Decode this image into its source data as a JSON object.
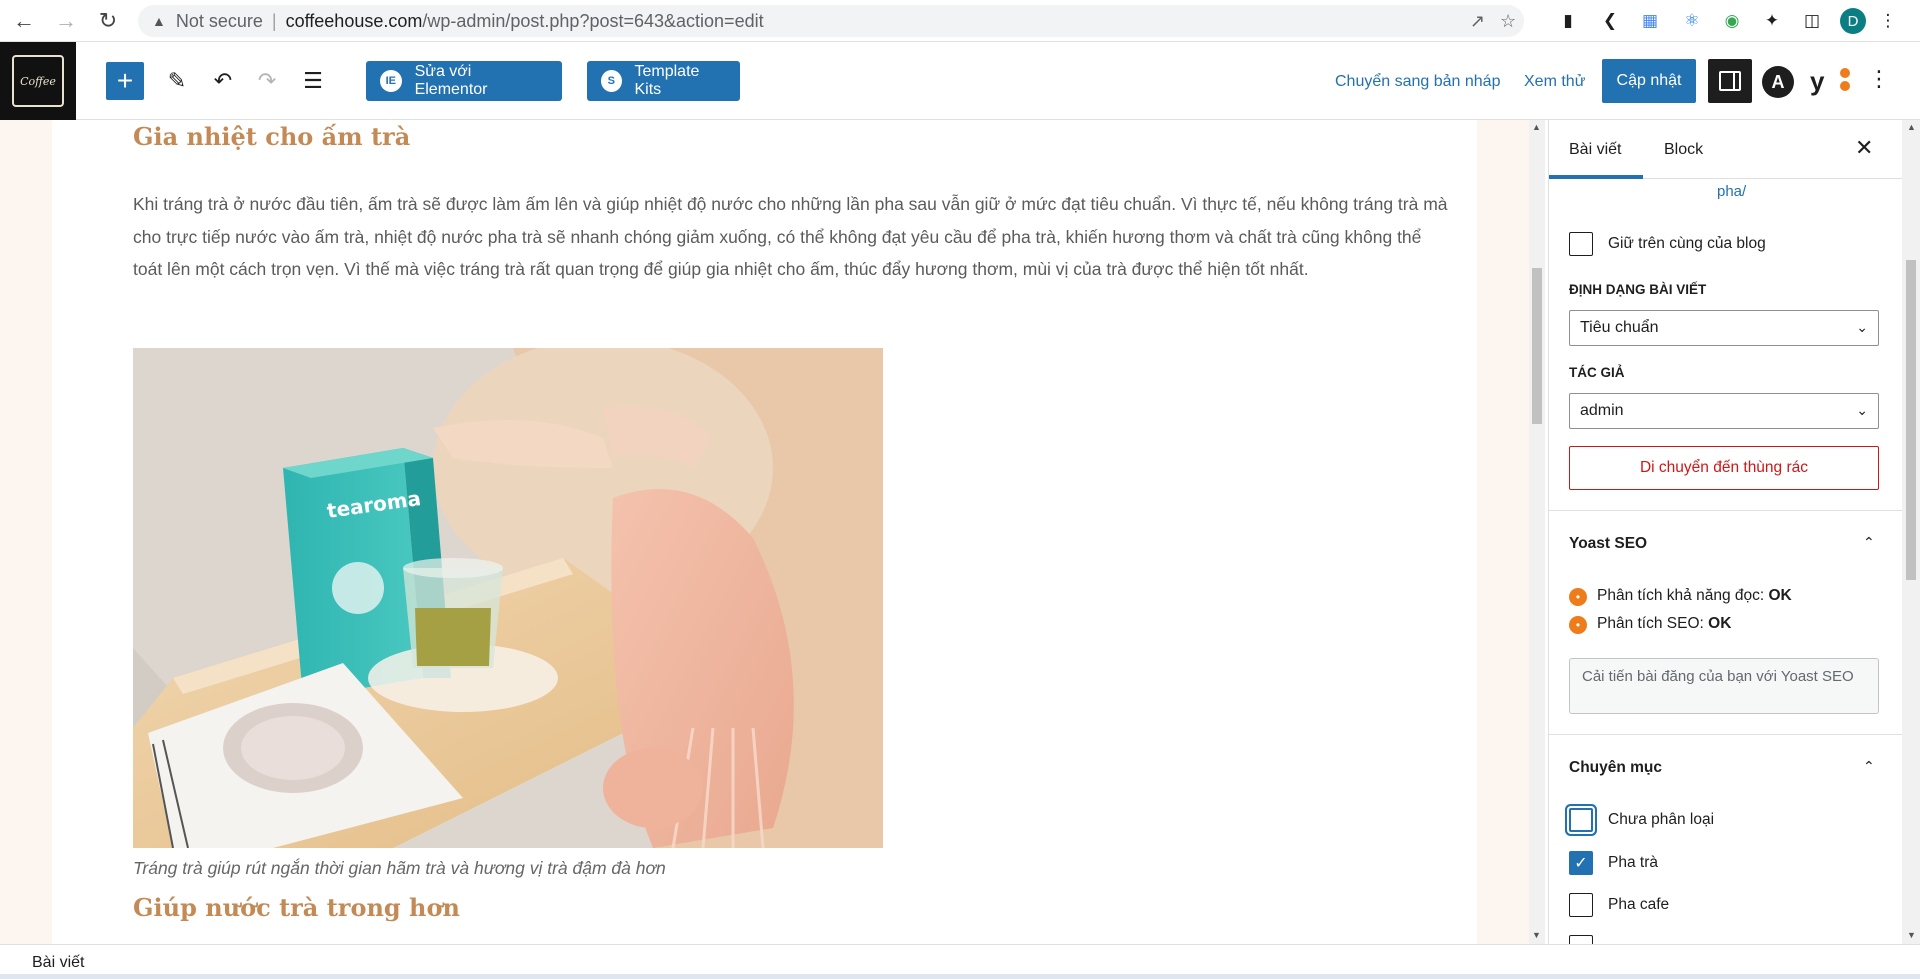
{
  "browser": {
    "not_secure": "Not secure",
    "separator": "|",
    "url_host": "coffeehouse.com",
    "url_path": "/wp-admin/post.php?post=643&action=edit",
    "profile_initial": "D"
  },
  "toolbar": {
    "elementor_label": "Sửa với Elementor",
    "template_kits_label": "Template Kits",
    "draft_label": "Chuyển sang bản nháp",
    "preview_label": "Xem thử",
    "update_label": "Cập nhật"
  },
  "content": {
    "heading1": "Gia nhiệt cho ấm trà",
    "paragraph": "Khi tráng trà ở nước đầu tiên, ấm trà sẽ được làm ấm lên và giúp nhiệt độ nước cho những lần pha sau vẫn giữ ở mức đạt tiêu chuẩn. Vì thực tế, nếu không tráng trà mà cho trực tiếp nước vào ấm trà, nhiệt độ nước pha trà sẽ nhanh chóng giảm xuống, có thể không đạt yêu cầu để pha trà, khiến hương thơm và chất trà cũng không thể toát lên một cách trọn vẹn. Vì thế mà việc tráng trà rất quan trọng để giúp gia nhiệt cho ấm, thúc đẩy hương thơm, mùi vị của trà được thể hiện tốt nhất.",
    "image_brand_text": "tearoma",
    "caption": "Tráng trà giúp rút ngắn thời gian hãm trà và hương vị trà đậm đà hơn",
    "heading2": "Giúp nước trà trong hơn"
  },
  "sidebar": {
    "tab_post": "Bài viết",
    "tab_block": "Block",
    "slug_tail": "pha/",
    "sticky_label": "Giữ trên cùng của blog",
    "format_label": "ĐỊNH DẠNG BÀI VIẾT",
    "format_value": "Tiêu chuẩn",
    "author_label": "TÁC GIẢ",
    "author_value": "admin",
    "trash_label": "Di chuyển đến thùng rác",
    "yoast_title": "Yoast SEO",
    "readability_label": "Phân tích khả năng đọc:",
    "readability_value": "OK",
    "seo_label": "Phân tích SEO:",
    "seo_value": "OK",
    "yoast_button": "Cải tiến bài đăng của bạn với Yoast SEO",
    "categories_title": "Chuyên mục",
    "categories": [
      {
        "label": "Chưa phân loại",
        "checked": false
      },
      {
        "label": "Pha trà",
        "checked": true
      },
      {
        "label": "Pha cafe",
        "checked": false
      }
    ]
  },
  "footer": {
    "breadcrumb": "Bài viết"
  },
  "icons": {
    "back": "arrow-left-icon",
    "forward": "arrow-right-icon",
    "reload": "reload-icon",
    "accent": "#2271b1",
    "danger": "#cc1818",
    "yoast_orange": "#ee7c1b",
    "heading_color": "#c48a55"
  }
}
